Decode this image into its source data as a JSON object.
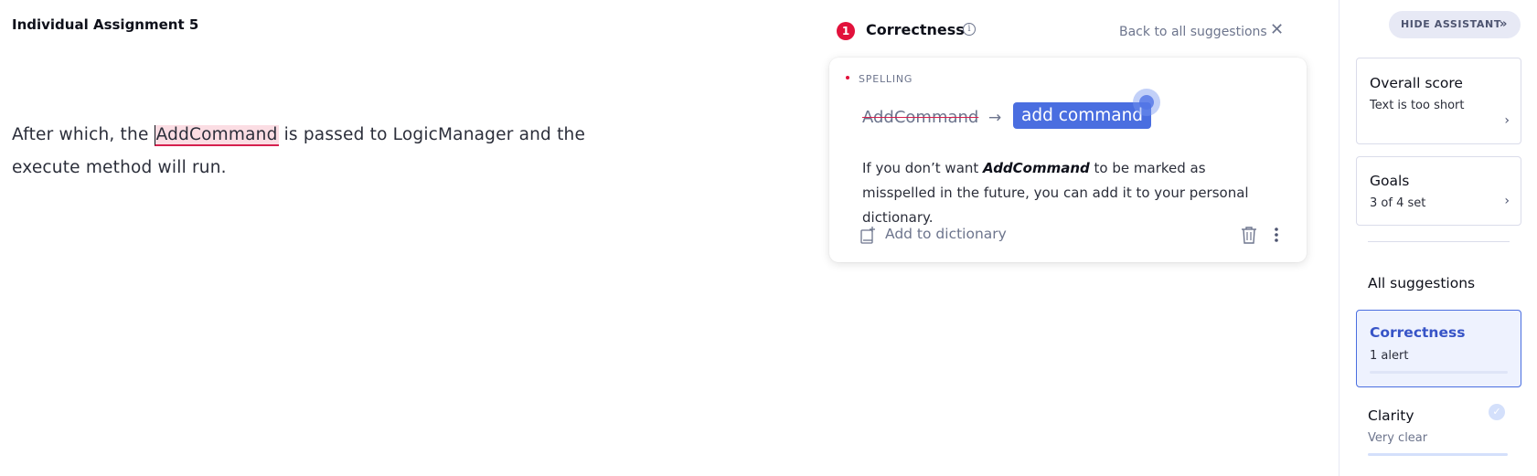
{
  "document": {
    "title": "Individual Assignment 5",
    "text_before": "After which, the ",
    "misspelled_word": "AddCommand",
    "text_after": " is passed to LogicManager and the execute method will run."
  },
  "suggestion_panel": {
    "alert_count": "1",
    "category": "Correctness",
    "back_link": "Back to all suggestions",
    "card": {
      "type": "SPELLING",
      "original": "AddCommand",
      "replacement": "add command",
      "explanation_prefix": "If you don’t want ",
      "explanation_word": "AddCommand",
      "explanation_suffix": " to be marked as misspelled in the future, you can add it to your personal dictionary.",
      "add_to_dictionary": "Add to dictionary"
    }
  },
  "sidebar": {
    "hide_button": "HIDE ASSISTANT",
    "overall_score": {
      "title": "Overall score",
      "subtitle": "Text is too short"
    },
    "goals": {
      "title": "Goals",
      "subtitle": "3 of 4 set"
    },
    "all_suggestions": "All suggestions",
    "correctness": {
      "title": "Correctness",
      "subtitle": "1 alert"
    },
    "clarity": {
      "title": "Clarity",
      "subtitle": "Very clear"
    }
  },
  "colors": {
    "accent": "#4a6ee0",
    "alert": "#e2113b",
    "misspelled_bg": "#fbdde3"
  }
}
